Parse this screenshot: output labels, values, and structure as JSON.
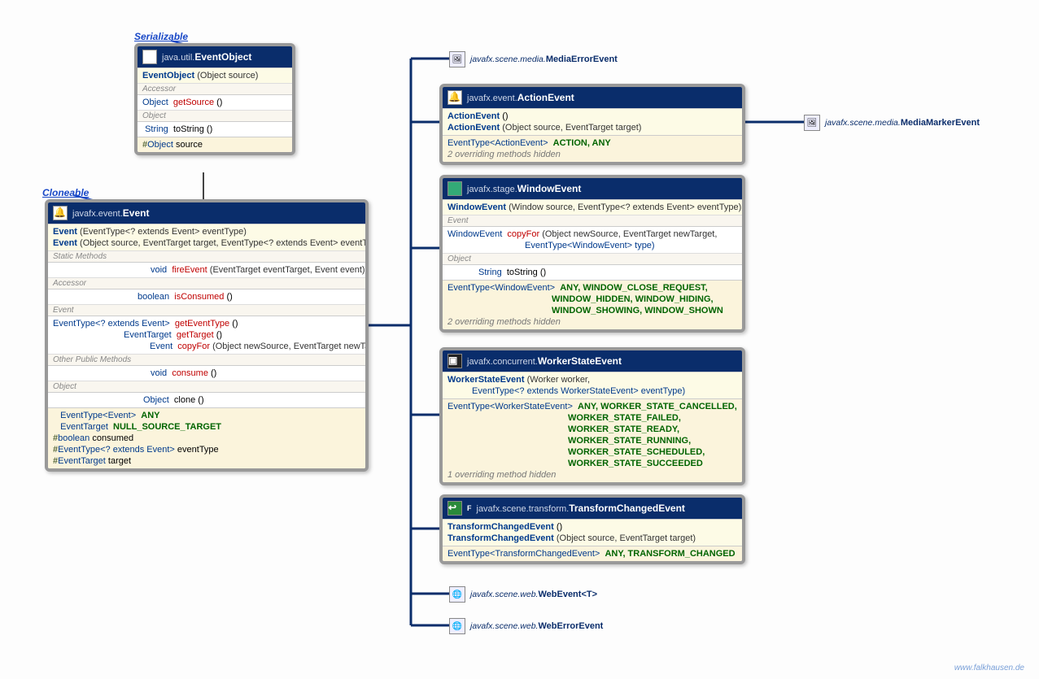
{
  "footer": "www.falkhausen.de",
  "interfaces": {
    "serializable": "Serializable",
    "cloneable": "Cloneable"
  },
  "ext": {
    "mediaError": {
      "pkg": "javafx.scene.media.",
      "cls": "MediaErrorEvent"
    },
    "mediaMarker": {
      "pkg": "javafx.scene.media.",
      "cls": "MediaMarkerEvent"
    },
    "webEvent": {
      "pkg": "javafx.scene.web.",
      "cls": "WebEvent<T>"
    },
    "webError": {
      "pkg": "javafx.scene.web.",
      "cls": "WebErrorEvent"
    }
  },
  "eventObject": {
    "pkg": "java.util.",
    "name": "EventObject",
    "ctor": {
      "sig": "EventObject",
      "params": "(Object source)"
    },
    "accessor_label": "Accessor",
    "getSource": {
      "type": "Object",
      "name": "getSource",
      "params": "()"
    },
    "object_label": "Object",
    "toString": {
      "type": "String",
      "name": "toString",
      "params": "()"
    },
    "field": {
      "prefix": "#",
      "type": "Object",
      "name": "source"
    }
  },
  "event": {
    "pkg": "javafx.event.",
    "name": "Event",
    "ctor1": {
      "sig": "Event",
      "params": "(EventType<? extends Event> eventType)"
    },
    "ctor2": {
      "sig": "Event",
      "params": "(Object source, EventTarget target, EventType<? extends Event> eventType)"
    },
    "static_label": "Static Methods",
    "fireEvent": {
      "type": "void",
      "name": "fireEvent",
      "params": "(EventTarget eventTarget, Event event)"
    },
    "accessor_label": "Accessor",
    "isConsumed": {
      "type": "boolean",
      "name": "isConsumed",
      "params": "()"
    },
    "event_label": "Event",
    "getEventType": {
      "type": "EventType<? extends Event>",
      "name": "getEventType",
      "params": "()"
    },
    "getTarget": {
      "type": "EventTarget",
      "name": "getTarget",
      "params": "()"
    },
    "copyFor": {
      "type": "Event",
      "name": "copyFor",
      "params": "(Object newSource, EventTarget newTarget)"
    },
    "other_label": "Other Public Methods",
    "consume": {
      "type": "void",
      "name": "consume",
      "params": "()"
    },
    "object_label": "Object",
    "clone": {
      "type": "Object",
      "name": "clone",
      "params": "()"
    },
    "const1": {
      "type": "EventType<Event>",
      "name": "ANY"
    },
    "const2": {
      "type": "EventTarget",
      "name": "NULL_SOURCE_TARGET"
    },
    "field1": {
      "prefix": "#",
      "type": "boolean",
      "name": "consumed"
    },
    "field2": {
      "prefix": "#",
      "type": "EventType<? extends Event>",
      "name": "eventType"
    },
    "field3": {
      "prefix": "#",
      "type": "EventTarget",
      "name": "target"
    }
  },
  "actionEvent": {
    "pkg": "javafx.event.",
    "name": "ActionEvent",
    "ctor1": {
      "sig": "ActionEvent",
      "params": "()"
    },
    "ctor2": {
      "sig": "ActionEvent",
      "params": "(Object source, EventTarget target)"
    },
    "consts": {
      "type": "EventType<ActionEvent>",
      "names": "ACTION, ANY"
    },
    "footer": "2 overriding methods hidden"
  },
  "windowEvent": {
    "pkg": "javafx.stage.",
    "name": "WindowEvent",
    "ctor": {
      "sig": "WindowEvent",
      "params": "(Window source, EventType<? extends Event> eventType)"
    },
    "event_label": "Event",
    "copyFor": {
      "type": "WindowEvent",
      "name": "copyFor",
      "params": "(Object newSource, EventTarget newTarget,"
    },
    "copyFor2": "EventType<WindowEvent> type)",
    "object_label": "Object",
    "toString": {
      "type": "String",
      "name": "toString",
      "params": "()"
    },
    "consts_type": "EventType<WindowEvent>",
    "consts1": "ANY, WINDOW_CLOSE_REQUEST,",
    "consts2": "WINDOW_HIDDEN, WINDOW_HIDING,",
    "consts3": "WINDOW_SHOWING, WINDOW_SHOWN",
    "footer": "2 overriding methods hidden"
  },
  "workerState": {
    "pkg": "javafx.concurrent.",
    "name": "WorkerStateEvent",
    "ctor": {
      "sig": "WorkerStateEvent",
      "params": "(Worker worker,"
    },
    "ctor2": "EventType<? extends WorkerStateEvent> eventType)",
    "consts_type": "EventType<WorkerStateEvent>",
    "consts1": "ANY, WORKER_STATE_CANCELLED,",
    "consts2": "WORKER_STATE_FAILED,",
    "consts3": "WORKER_STATE_READY,",
    "consts4": "WORKER_STATE_RUNNING,",
    "consts5": "WORKER_STATE_SCHEDULED,",
    "consts6": "WORKER_STATE_SUCCEEDED",
    "footer": "1 overriding method hidden"
  },
  "transformChanged": {
    "pkg": "javafx.scene.transform.",
    "name": "TransformChangedEvent",
    "final_marker": "F",
    "ctor1": {
      "sig": "TransformChangedEvent",
      "params": "()"
    },
    "ctor2": {
      "sig": "TransformChangedEvent",
      "params": "(Object source, EventTarget target)"
    },
    "consts": {
      "type": "EventType<TransformChangedEvent>",
      "names": "ANY, TRANSFORM_CHANGED"
    }
  }
}
